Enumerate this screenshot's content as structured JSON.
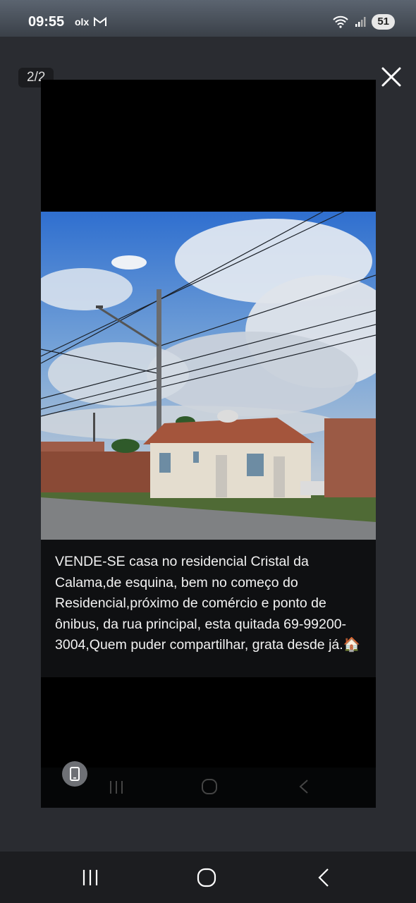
{
  "status_bar": {
    "time": "09:55",
    "app_icons": [
      "olx-icon",
      "gmail-icon"
    ],
    "olx_label": "olx",
    "battery": "51"
  },
  "viewer": {
    "counter": "2/2",
    "caption": "VENDE-SE casa no residencial Cristal da Calama,de esquina, bem no começo do Residencial,próximo de comércio e ponto de ônibus, da rua principal, esta quitada 69-99200-3004,Quem puder compartilhar, grata desde já.🏠"
  },
  "nav": {
    "items": [
      "recent-apps-icon",
      "home-icon",
      "back-icon"
    ]
  },
  "colors": {
    "background": "#212327",
    "sky": "#3f7fd0",
    "roof": "#a4553c",
    "wall": "#e4ddcf"
  }
}
